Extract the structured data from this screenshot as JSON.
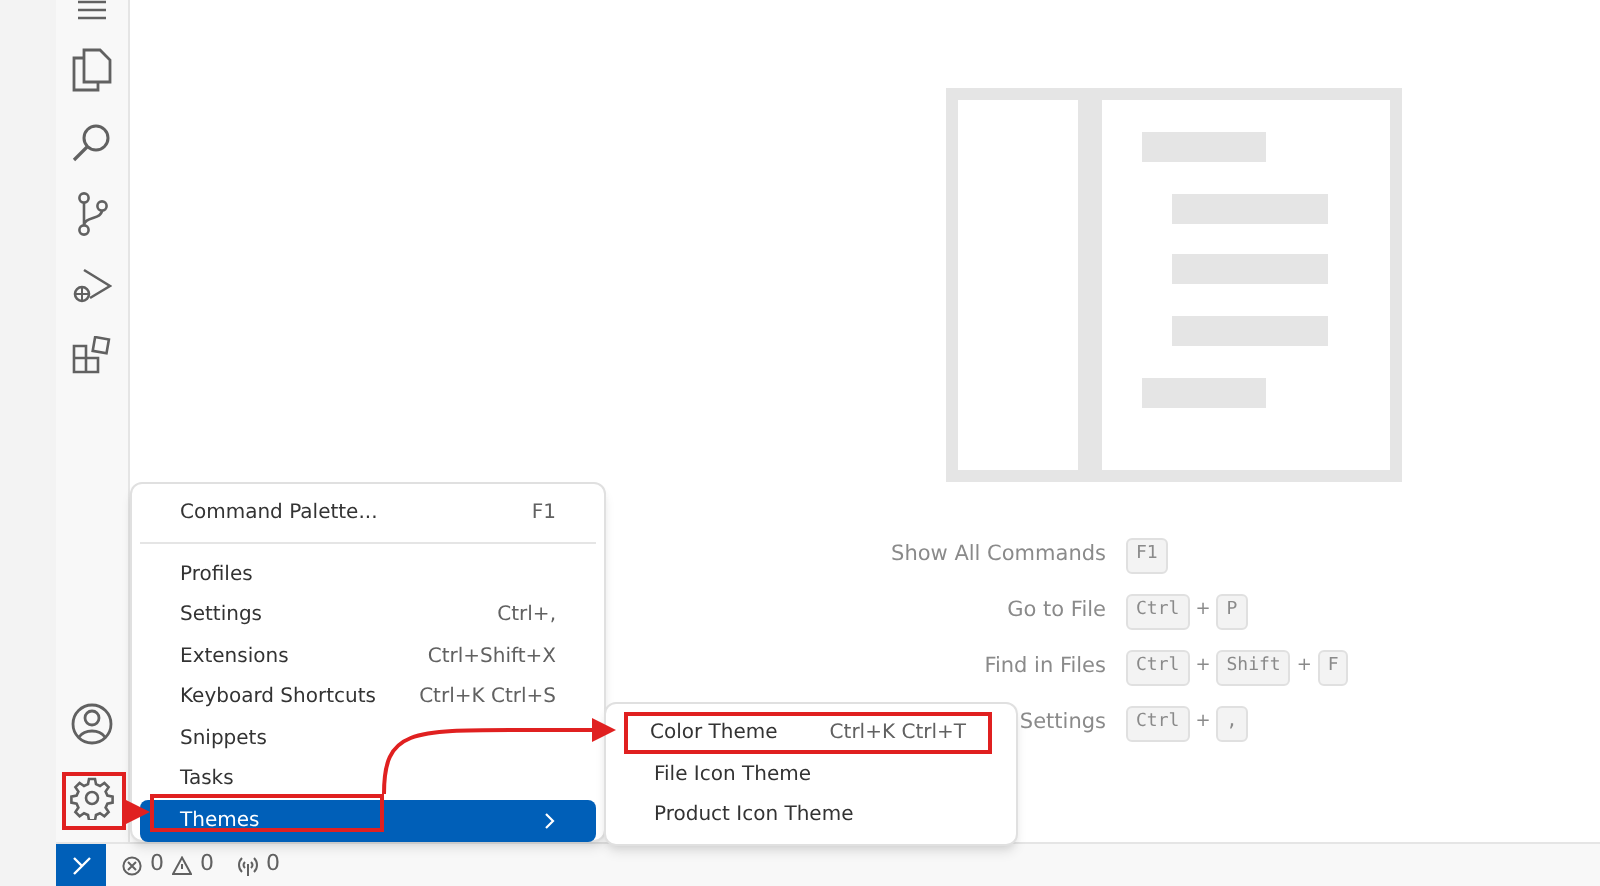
{
  "menu": {
    "items": [
      {
        "label": "Command Palette...",
        "shortcut": "F1",
        "selected": false,
        "submenu": false,
        "separator_after": true
      },
      {
        "label": "Profiles",
        "selected": false,
        "submenu": false,
        "separator_after": false
      },
      {
        "label": "Settings",
        "shortcut": "Ctrl+,",
        "selected": false,
        "submenu": false,
        "separator_after": false
      },
      {
        "label": "Extensions",
        "shortcut": "Ctrl+Shift+X",
        "selected": false,
        "submenu": false,
        "separator_after": false
      },
      {
        "label": "Keyboard Shortcuts",
        "shortcut": "Ctrl+K Ctrl+S",
        "selected": false,
        "submenu": false,
        "separator_after": false
      },
      {
        "label": "Snippets",
        "selected": false,
        "submenu": false,
        "separator_after": false
      },
      {
        "label": "Tasks",
        "selected": false,
        "submenu": false,
        "separator_after": false
      },
      {
        "label": "Themes",
        "selected": true,
        "submenu": true,
        "separator_after": false
      }
    ]
  },
  "submenu": {
    "items": [
      {
        "label": "Color Theme",
        "shortcut": "Ctrl+K Ctrl+T",
        "annotated": true
      },
      {
        "label": "File Icon Theme",
        "annotated": false
      },
      {
        "label": "Product Icon Theme",
        "annotated": false
      }
    ]
  },
  "hints": [
    {
      "label": "Show All Commands",
      "keys": [
        {
          "kind": "key",
          "text": "F1"
        }
      ]
    },
    {
      "label": "Go to File",
      "keys": [
        {
          "kind": "key",
          "text": "Ctrl"
        },
        {
          "kind": "plus",
          "text": "+"
        },
        {
          "kind": "key",
          "text": "P"
        }
      ]
    },
    {
      "label": "Find in Files",
      "keys": [
        {
          "kind": "key",
          "text": "Ctrl"
        },
        {
          "kind": "plus",
          "text": "+"
        },
        {
          "kind": "key",
          "text": "Shift"
        },
        {
          "kind": "plus",
          "text": "+"
        },
        {
          "kind": "key",
          "text": "F"
        }
      ]
    },
    {
      "label": "Settings",
      "keys": [
        {
          "kind": "key",
          "text": "Ctrl"
        },
        {
          "kind": "plus",
          "text": "+"
        },
        {
          "kind": "key",
          "text": ","
        }
      ]
    }
  ],
  "status_bar": {
    "errors": "0",
    "warnings": "0",
    "ports": "0"
  }
}
